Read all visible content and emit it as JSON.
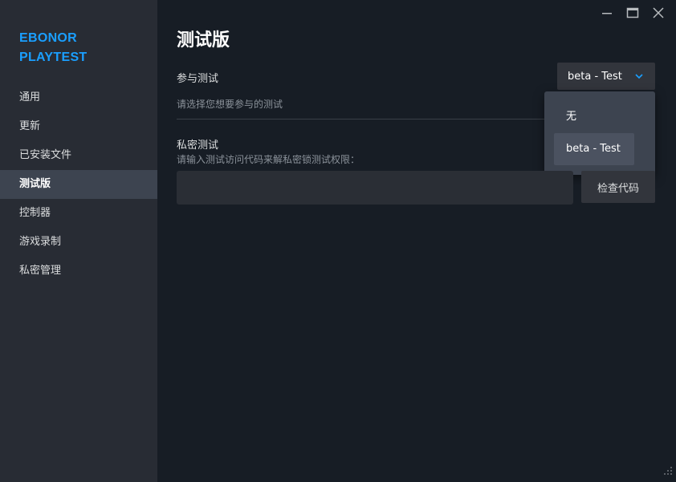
{
  "app": {
    "title_line1": "EBONOR",
    "title_line2": "PLAYTEST"
  },
  "sidebar": {
    "items": [
      {
        "label": "通用"
      },
      {
        "label": "更新"
      },
      {
        "label": "已安装文件"
      },
      {
        "label": "测试版",
        "active": true
      },
      {
        "label": "控制器"
      },
      {
        "label": "游戏录制"
      },
      {
        "label": "私密管理"
      }
    ]
  },
  "window_controls": {
    "icons": [
      "minimize-icon",
      "maximize-icon",
      "close-icon"
    ]
  },
  "main": {
    "title": "测试版",
    "participate": {
      "label": "参与测试",
      "hint": "请选择您想要参与的测试",
      "selected": "beta - Test",
      "options": [
        "无",
        "beta - Test"
      ]
    },
    "private": {
      "label": "私密测试",
      "hint": "请输入测试访问代码来解私密锁测试权限：",
      "input_value": "",
      "button_label": "检查代码"
    }
  },
  "colors": {
    "accent": "#1a9fff",
    "background": "#171d25",
    "sidebar": "#282c34",
    "active_item": "#3d4450"
  }
}
